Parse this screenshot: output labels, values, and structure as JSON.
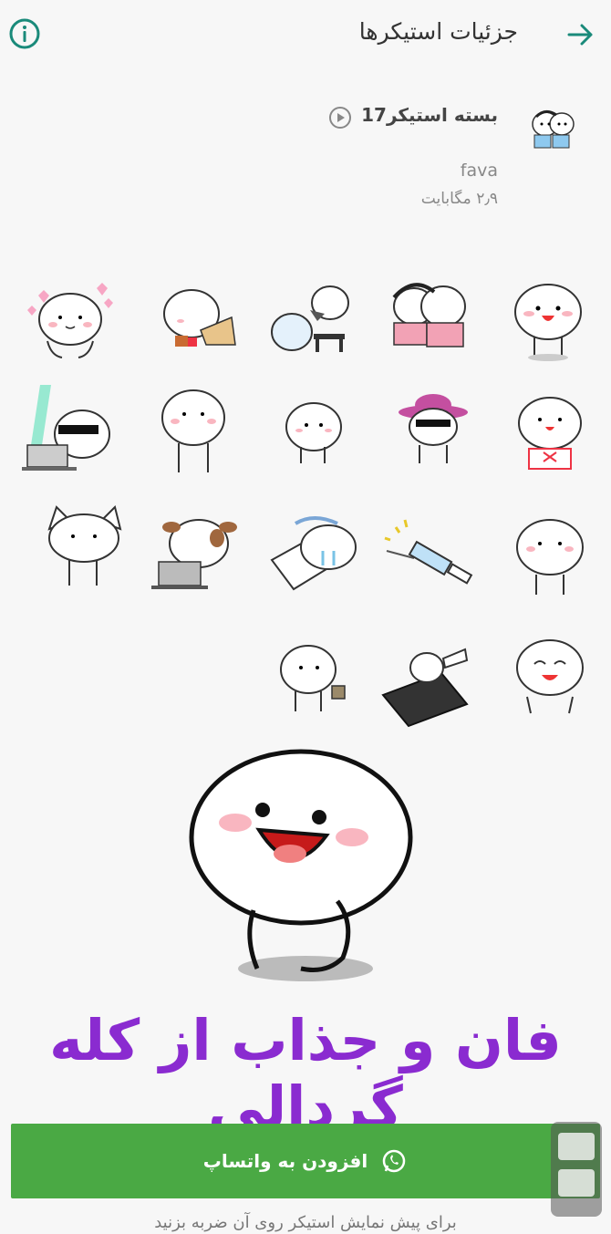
{
  "header": {
    "title": "جزئیات استیکرها",
    "back_icon": "arrow-right-icon",
    "info_icon": "info-icon",
    "accent": "#1a8a7a"
  },
  "pack": {
    "name": "بسته استیکر17",
    "author": "fava",
    "size": "۲٫۹ مگابایت"
  },
  "stickers": [
    "hearts-blob",
    "eating-blob",
    "watering-blob",
    "couple-blob",
    "smile-blob",
    "laptop-sunglasses-blob",
    "standing-blob",
    "small-blob",
    "hat-blob",
    "bow-blob",
    "cat-blob",
    "dog-laptop-blob",
    "pillow-blob",
    "syringe",
    "peek-blob",
    "holding-blob",
    "phone-hand",
    "laughing-blob"
  ],
  "promo": {
    "text": "فان و جذاب از کله گردالی",
    "color": "#8a2bd0"
  },
  "add_button": {
    "label": "افزودن به واتساپ",
    "color": "#4aa944",
    "icon": "whatsapp-icon"
  },
  "hint": "برای پیش نمایش استیکر روی آن ضربه بزنید"
}
